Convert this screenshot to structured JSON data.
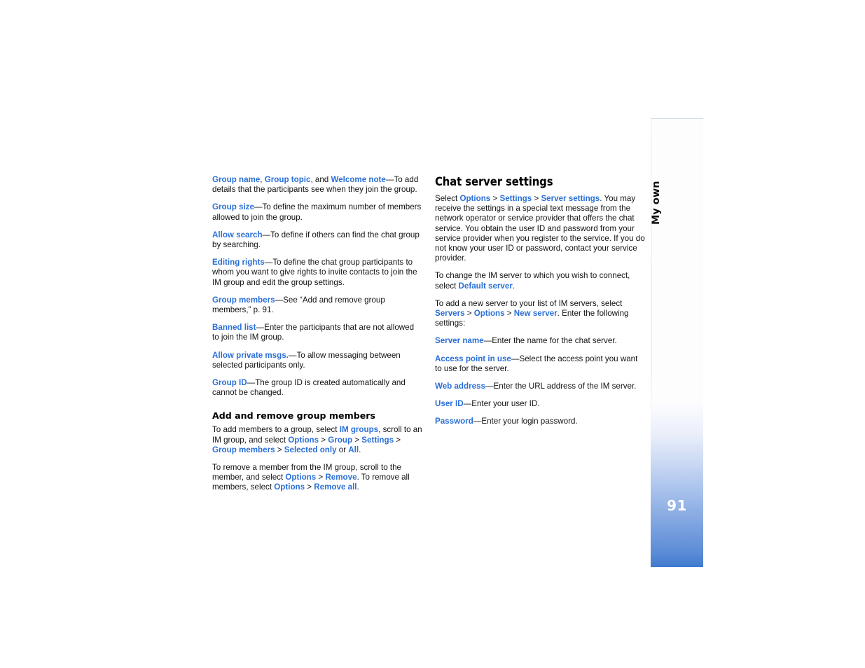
{
  "page": {
    "number": "91",
    "tab_label": "My own",
    "accent_color": "#2A6FD6",
    "text_color": "#121212"
  },
  "left_column": {
    "paragraphs": [
      {
        "id": "group-name-topic-welcome",
        "runs": [
          {
            "t": "Group name",
            "s": "link"
          },
          {
            "t": ", ",
            "s": "plain"
          },
          {
            "t": "Group topic",
            "s": "link"
          },
          {
            "t": ", and ",
            "s": "plain"
          },
          {
            "t": "Welcome note",
            "s": "link"
          },
          {
            "t": "—To add details that the participants see when they join the group.",
            "s": "plain"
          }
        ]
      },
      {
        "id": "group-size",
        "runs": [
          {
            "t": "Group size",
            "s": "link"
          },
          {
            "t": "—To define the maximum number of members allowed to join the group.",
            "s": "plain"
          }
        ]
      },
      {
        "id": "allow-search",
        "runs": [
          {
            "t": "Allow search",
            "s": "link"
          },
          {
            "t": "—To define if others can find the chat group by searching.",
            "s": "plain"
          }
        ]
      },
      {
        "id": "editing-rights",
        "runs": [
          {
            "t": "Editing rights",
            "s": "link"
          },
          {
            "t": "—To define the chat group participants to whom you want to give rights to invite contacts to join the IM group and edit the group settings.",
            "s": "plain"
          }
        ]
      },
      {
        "id": "group-members",
        "runs": [
          {
            "t": "Group members",
            "s": "link"
          },
          {
            "t": "—See “Add and remove group members,” p. 91.",
            "s": "plain"
          }
        ]
      },
      {
        "id": "banned-list",
        "runs": [
          {
            "t": "Banned list",
            "s": "link"
          },
          {
            "t": "—Enter the participants that are not allowed to join the IM group.",
            "s": "plain"
          }
        ]
      },
      {
        "id": "allow-private-msgs",
        "runs": [
          {
            "t": "Allow private msgs.",
            "s": "link"
          },
          {
            "t": "—To allow messaging between selected participants only.",
            "s": "plain"
          }
        ]
      },
      {
        "id": "group-id",
        "runs": [
          {
            "t": "Group ID",
            "s": "link"
          },
          {
            "t": "—The group ID is created automatically and cannot be changed.",
            "s": "plain"
          }
        ]
      }
    ],
    "subheading": "Add and remove group members",
    "paragraphs_after": [
      {
        "id": "add-members",
        "runs": [
          {
            "t": "To add members to a group, select ",
            "s": "plain"
          },
          {
            "t": "IM groups",
            "s": "link"
          },
          {
            "t": ", scroll to an IM group, and select ",
            "s": "plain"
          },
          {
            "t": "Options",
            "s": "link"
          },
          {
            "t": " > ",
            "s": "plain"
          },
          {
            "t": "Group",
            "s": "link"
          },
          {
            "t": " > ",
            "s": "plain"
          },
          {
            "t": "Settings",
            "s": "link"
          },
          {
            "t": " > ",
            "s": "plain"
          },
          {
            "t": "Group members",
            "s": "link"
          },
          {
            "t": " > ",
            "s": "plain"
          },
          {
            "t": "Selected only",
            "s": "link"
          },
          {
            "t": " or ",
            "s": "plain"
          },
          {
            "t": "All",
            "s": "link"
          },
          {
            "t": ".",
            "s": "plain"
          }
        ]
      },
      {
        "id": "remove-members",
        "runs": [
          {
            "t": "To remove a member from the IM group, scroll to the member, and select ",
            "s": "plain"
          },
          {
            "t": "Options",
            "s": "link"
          },
          {
            "t": " > ",
            "s": "plain"
          },
          {
            "t": "Remove",
            "s": "link"
          },
          {
            "t": ". To remove all members, select ",
            "s": "plain"
          },
          {
            "t": "Options",
            "s": "link"
          },
          {
            "t": " > ",
            "s": "plain"
          },
          {
            "t": "Remove all",
            "s": "link"
          },
          {
            "t": ".",
            "s": "plain"
          }
        ]
      }
    ]
  },
  "right_column": {
    "heading": "Chat server settings",
    "paragraphs": [
      {
        "id": "select-server-settings",
        "runs": [
          {
            "t": "Select ",
            "s": "plain"
          },
          {
            "t": "Options",
            "s": "link"
          },
          {
            "t": " > ",
            "s": "plain"
          },
          {
            "t": "Settings",
            "s": "link"
          },
          {
            "t": " > ",
            "s": "plain"
          },
          {
            "t": "Server settings",
            "s": "link"
          },
          {
            "t": ". You may receive the settings in a special text message from the network operator or service provider that offers the chat service. You obtain the user ID and password from your service provider when you register to the service. If you do not know your user ID or password, contact your service provider.",
            "s": "plain"
          }
        ]
      },
      {
        "id": "default-server",
        "runs": [
          {
            "t": "To change the IM server to which you wish to connect, select ",
            "s": "plain"
          },
          {
            "t": "Default server",
            "s": "link"
          },
          {
            "t": ".",
            "s": "plain"
          }
        ]
      },
      {
        "id": "new-server",
        "runs": [
          {
            "t": "To add a new server to your list of IM servers, select ",
            "s": "plain"
          },
          {
            "t": "Servers",
            "s": "link"
          },
          {
            "t": " > ",
            "s": "plain"
          },
          {
            "t": "Options",
            "s": "link"
          },
          {
            "t": " > ",
            "s": "plain"
          },
          {
            "t": "New server",
            "s": "link"
          },
          {
            "t": ". Enter the following settings:",
            "s": "plain"
          }
        ]
      },
      {
        "id": "server-name",
        "runs": [
          {
            "t": "Server name",
            "s": "link"
          },
          {
            "t": "—Enter the name for the chat server.",
            "s": "plain"
          }
        ]
      },
      {
        "id": "access-point-in-use",
        "runs": [
          {
            "t": "Access point in use",
            "s": "link"
          },
          {
            "t": "—Select the access point you want to use for the server.",
            "s": "plain"
          }
        ]
      },
      {
        "id": "web-address",
        "runs": [
          {
            "t": "Web address",
            "s": "link"
          },
          {
            "t": "—Enter the URL address of the IM server.",
            "s": "plain"
          }
        ]
      },
      {
        "id": "user-id",
        "runs": [
          {
            "t": "User ID",
            "s": "link"
          },
          {
            "t": "—Enter your user ID.",
            "s": "plain"
          }
        ]
      },
      {
        "id": "password",
        "runs": [
          {
            "t": "Password",
            "s": "link"
          },
          {
            "t": "—Enter your login password.",
            "s": "plain"
          }
        ]
      }
    ]
  }
}
